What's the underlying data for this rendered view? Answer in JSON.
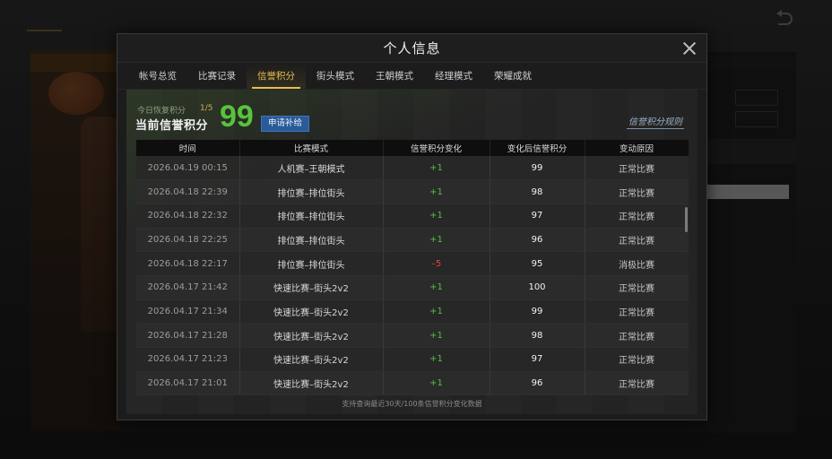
{
  "modal": {
    "title": "个人信息",
    "tabs": [
      "帐号总览",
      "比赛记录",
      "信誉积分",
      "街头模式",
      "王朝模式",
      "经理模式",
      "荣耀成就"
    ],
    "active_tab": "信誉积分"
  },
  "credit": {
    "recover_label": "今日恢复积分",
    "recover_count": "1/5",
    "current_label": "当前信誉积分",
    "score": "99",
    "apply_button": "申请补给",
    "rules_link": "信誉积分规则"
  },
  "table": {
    "headers": [
      "时间",
      "比赛模式",
      "信誉积分变化",
      "变化后信誉积分",
      "变动原因"
    ],
    "rows": [
      {
        "time": "2026.04.19  00:15",
        "mode": "人机赛–王朝模式",
        "change": "+1",
        "after": "99",
        "reason": "正常比赛"
      },
      {
        "time": "2026.04.18  22:39",
        "mode": "排位赛–排位街头",
        "change": "+1",
        "after": "98",
        "reason": "正常比赛"
      },
      {
        "time": "2026.04.18  22:32",
        "mode": "排位赛–排位街头",
        "change": "+1",
        "after": "97",
        "reason": "正常比赛"
      },
      {
        "time": "2026.04.18  22:25",
        "mode": "排位赛–排位街头",
        "change": "+1",
        "after": "96",
        "reason": "正常比赛"
      },
      {
        "time": "2026.04.18  22:17",
        "mode": "排位赛–排位街头",
        "change": "–5",
        "after": "95",
        "reason": "消极比赛"
      },
      {
        "time": "2026.04.17  21:42",
        "mode": "快速比赛–街头2v2",
        "change": "+1",
        "after": "100",
        "reason": "正常比赛"
      },
      {
        "time": "2026.04.17  21:34",
        "mode": "快速比赛–街头2v2",
        "change": "+1",
        "after": "99",
        "reason": "正常比赛"
      },
      {
        "time": "2026.04.17  21:28",
        "mode": "快速比赛–街头2v2",
        "change": "+1",
        "after": "98",
        "reason": "正常比赛"
      },
      {
        "time": "2026.04.17  21:23",
        "mode": "快速比赛–街头2v2",
        "change": "+1",
        "after": "97",
        "reason": "正常比赛"
      },
      {
        "time": "2026.04.17  21:01",
        "mode": "快速比赛–街头2v2",
        "change": "+1",
        "after": "96",
        "reason": "正常比赛"
      }
    ]
  },
  "footer_note": "支持查询最近30天/100条信誉积分变化数据",
  "colors": {
    "accent": "#e6c04a",
    "score_green": "#58c33c",
    "positive": "#4ec43a",
    "negative": "#e0453a",
    "button_blue": "#2a5b99"
  }
}
